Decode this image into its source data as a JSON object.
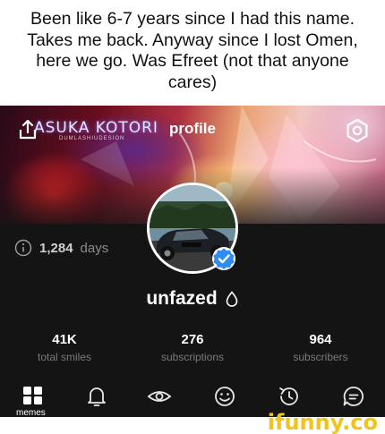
{
  "caption": {
    "text": "Been like 6-7 years since I had this name. Takes me back. Anyway since I lost Omen, here we go. Was Efreet (not that anyone cares)"
  },
  "header": {
    "title": "profile",
    "cover_text": "ASUKA KOTORI",
    "cover_subtext": "DUMLASHIUDESION"
  },
  "profile": {
    "days_value": "1,284",
    "days_unit": "days",
    "username": "unfazed"
  },
  "stats": [
    {
      "value": "41K",
      "label": "total smiles"
    },
    {
      "value": "276",
      "label": "subscriptions"
    },
    {
      "value": "964",
      "label": "subscribers"
    }
  ],
  "tabbar": {
    "memes_label": "memes",
    "icons": [
      "grid-icon",
      "bell-icon",
      "eye-icon",
      "smile-icon",
      "history-icon",
      "chat-icon"
    ]
  },
  "watermark": "ifunny.co",
  "colors": {
    "background": "#141414",
    "watermark": "#f2c318",
    "verified": "#2f8cf0"
  }
}
